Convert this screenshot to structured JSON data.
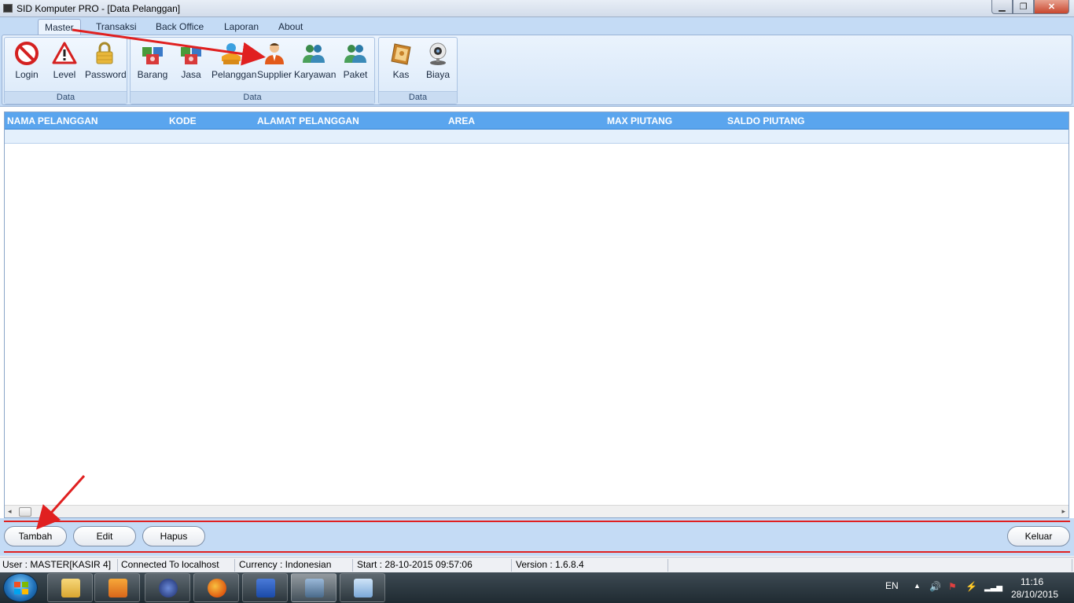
{
  "window": {
    "title": "SID Komputer PRO - [Data Pelanggan]",
    "minimize_icon": "minimize-icon",
    "maximize_icon": "maximize-icon",
    "close_icon": "close-icon",
    "min_glyph": "▁",
    "max_glyph": "❐",
    "close_glyph": "✕"
  },
  "ribbon": {
    "tabs": [
      {
        "label": "Master",
        "active": true
      },
      {
        "label": "Transaksi"
      },
      {
        "label": "Back Office"
      },
      {
        "label": "Laporan"
      },
      {
        "label": "About"
      }
    ],
    "groups": [
      {
        "label": "Data",
        "buttons": [
          {
            "label": "Login",
            "icon": "no-entry-icon"
          },
          {
            "label": "Level",
            "icon": "warning-icon"
          },
          {
            "label": "Password",
            "icon": "lock-icon"
          }
        ]
      },
      {
        "label": "Data",
        "buttons": [
          {
            "label": "Barang",
            "icon": "boxes-icon"
          },
          {
            "label": "Jasa",
            "icon": "boxes-icon"
          },
          {
            "label": "Pelanggan",
            "icon": "customer-icon"
          },
          {
            "label": "Supplier",
            "icon": "supplier-person-icon"
          },
          {
            "label": "Karyawan",
            "icon": "users-icon"
          },
          {
            "label": "Paket",
            "icon": "users-icon"
          }
        ]
      },
      {
        "label": "Data",
        "buttons": [
          {
            "label": "Kas",
            "icon": "ledger-book-icon"
          },
          {
            "label": "Biaya",
            "icon": "webcam-icon"
          }
        ]
      }
    ]
  },
  "grid": {
    "columns": [
      "NAMA PELANGGAN",
      "KODE",
      "ALAMAT PELANGGAN",
      "AREA",
      "MAX PIUTANG",
      "SALDO PIUTANG"
    ],
    "rows": [],
    "scroll_left": "◂",
    "scroll_right": "▸"
  },
  "buttons": {
    "tambah": "Tambah",
    "edit": "Edit",
    "hapus": "Hapus",
    "keluar": "Keluar"
  },
  "status": {
    "user": "User : MASTER[KASIR 4]",
    "connection": "Connected To localhost",
    "currency": "Currency : Indonesian",
    "start": "Start  : 28-10-2015 09:57:06",
    "version": "Version : 1.6.8.4"
  },
  "taskbar": {
    "items": [
      "explorer-icon",
      "media-player-icon",
      "media-center-icon",
      "firefox-icon",
      "word-icon",
      "remote-desktop-icon",
      "notepad-icon"
    ],
    "tray": {
      "language": "EN",
      "time": "11:16",
      "date": "28/10/2015"
    }
  },
  "colors": {
    "ribbon_bg": "#c4dbf5",
    "grid_header": "#5aa5ee",
    "annotation_arrow": "#e02020"
  }
}
